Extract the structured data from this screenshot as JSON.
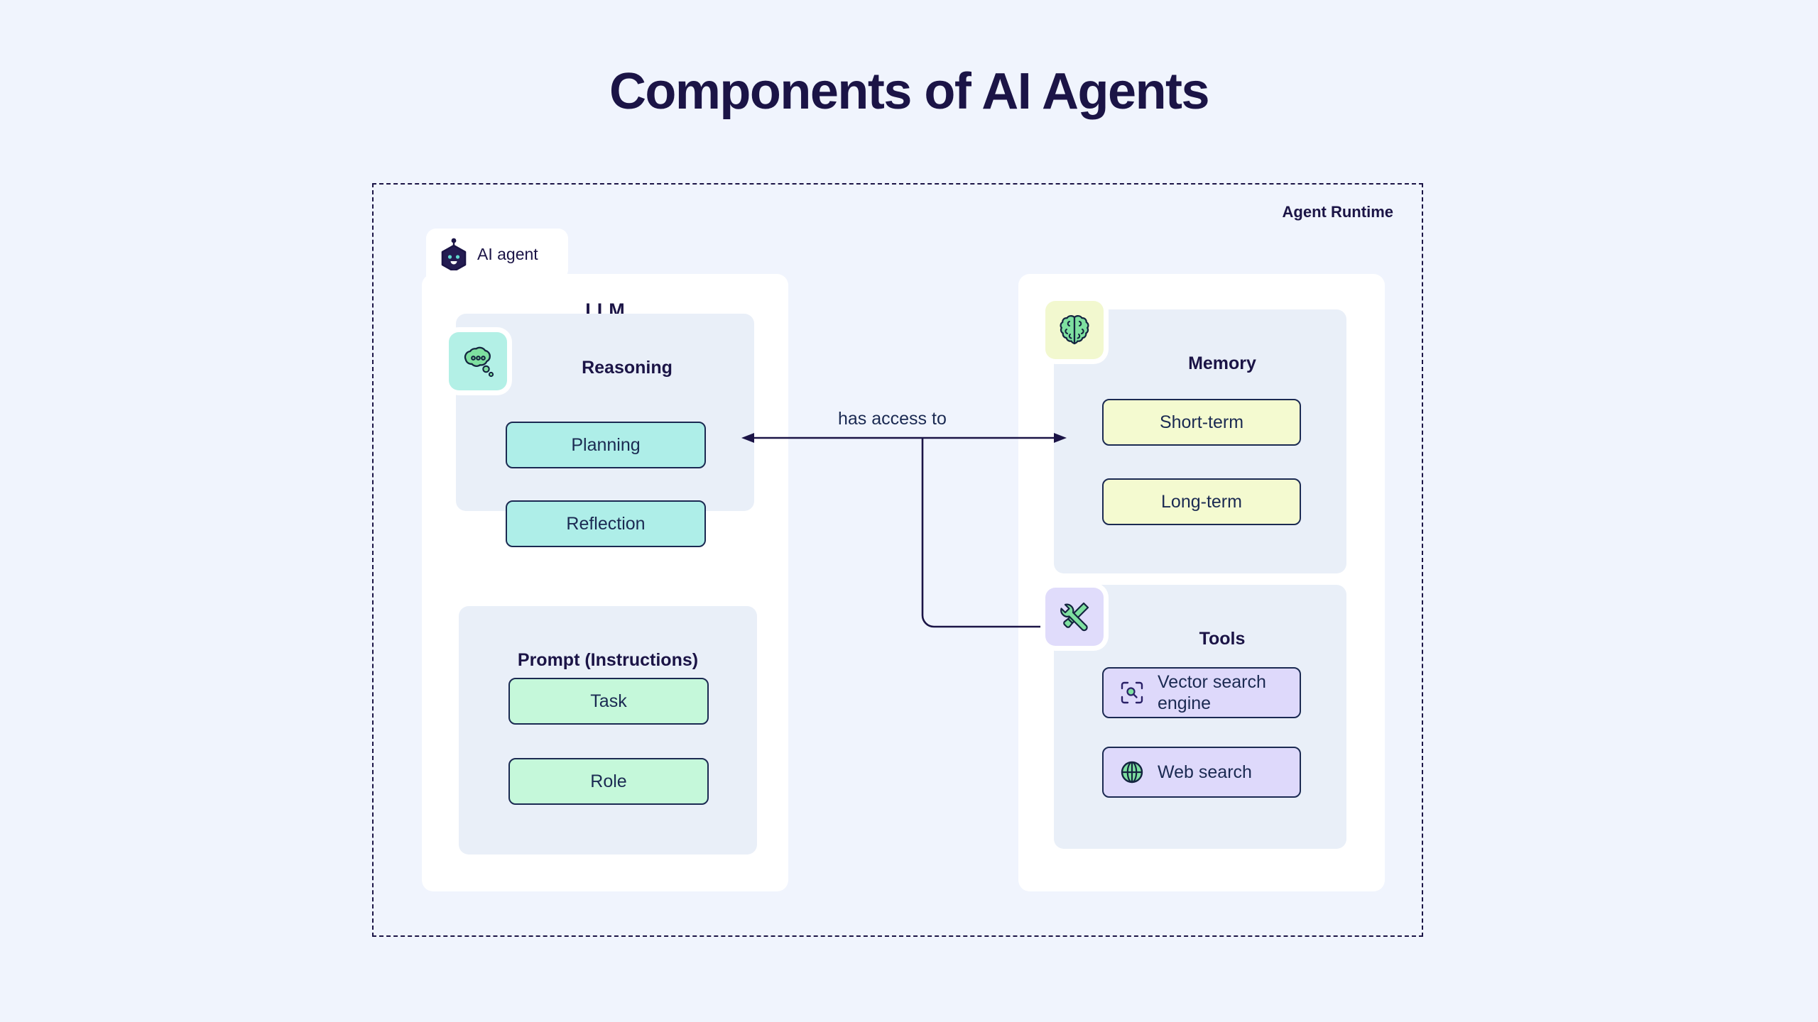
{
  "page": {
    "title": "Components of AI Agents",
    "background_color": "#f0f4fd",
    "text_color": "#1b1446"
  },
  "runtime": {
    "label": "Agent Runtime",
    "border_style": "dashed",
    "border_color": "#1b1446"
  },
  "agent_badge": {
    "label": "AI agent",
    "icon": "robot-hexagon-icon"
  },
  "connector": {
    "label": "has access to",
    "color": "#1b2a52",
    "style": "double-headed-arrow-with-branch"
  },
  "left_panel": {
    "title": "LLM",
    "sections": [
      {
        "title": "Reasoning",
        "icon": "thought-bubble-icon",
        "icon_bg": "#b3f0e6",
        "item_color": "#aeeee8",
        "items": [
          {
            "label": "Planning"
          },
          {
            "label": "Reflection"
          }
        ]
      },
      {
        "title": "Prompt (Instructions)",
        "icon": null,
        "item_color": "#c5f8da",
        "items": [
          {
            "label": "Task"
          },
          {
            "label": "Role"
          }
        ]
      }
    ]
  },
  "right_panel": {
    "sections": [
      {
        "title": "Memory",
        "icon": "brain-icon",
        "icon_bg": "#f2f8cf",
        "item_color": "#f4fad0",
        "items": [
          {
            "label": "Short-term"
          },
          {
            "label": "Long-term"
          }
        ]
      },
      {
        "title": "Tools",
        "icon": "tools-wrench-screwdriver-icon",
        "icon_bg": "#e0dcfb",
        "item_color": "#ded9fb",
        "items": [
          {
            "label": "Vector search engine",
            "icon": "scan-search-icon"
          },
          {
            "label": "Web search",
            "icon": "globe-icon"
          }
        ]
      }
    ]
  }
}
